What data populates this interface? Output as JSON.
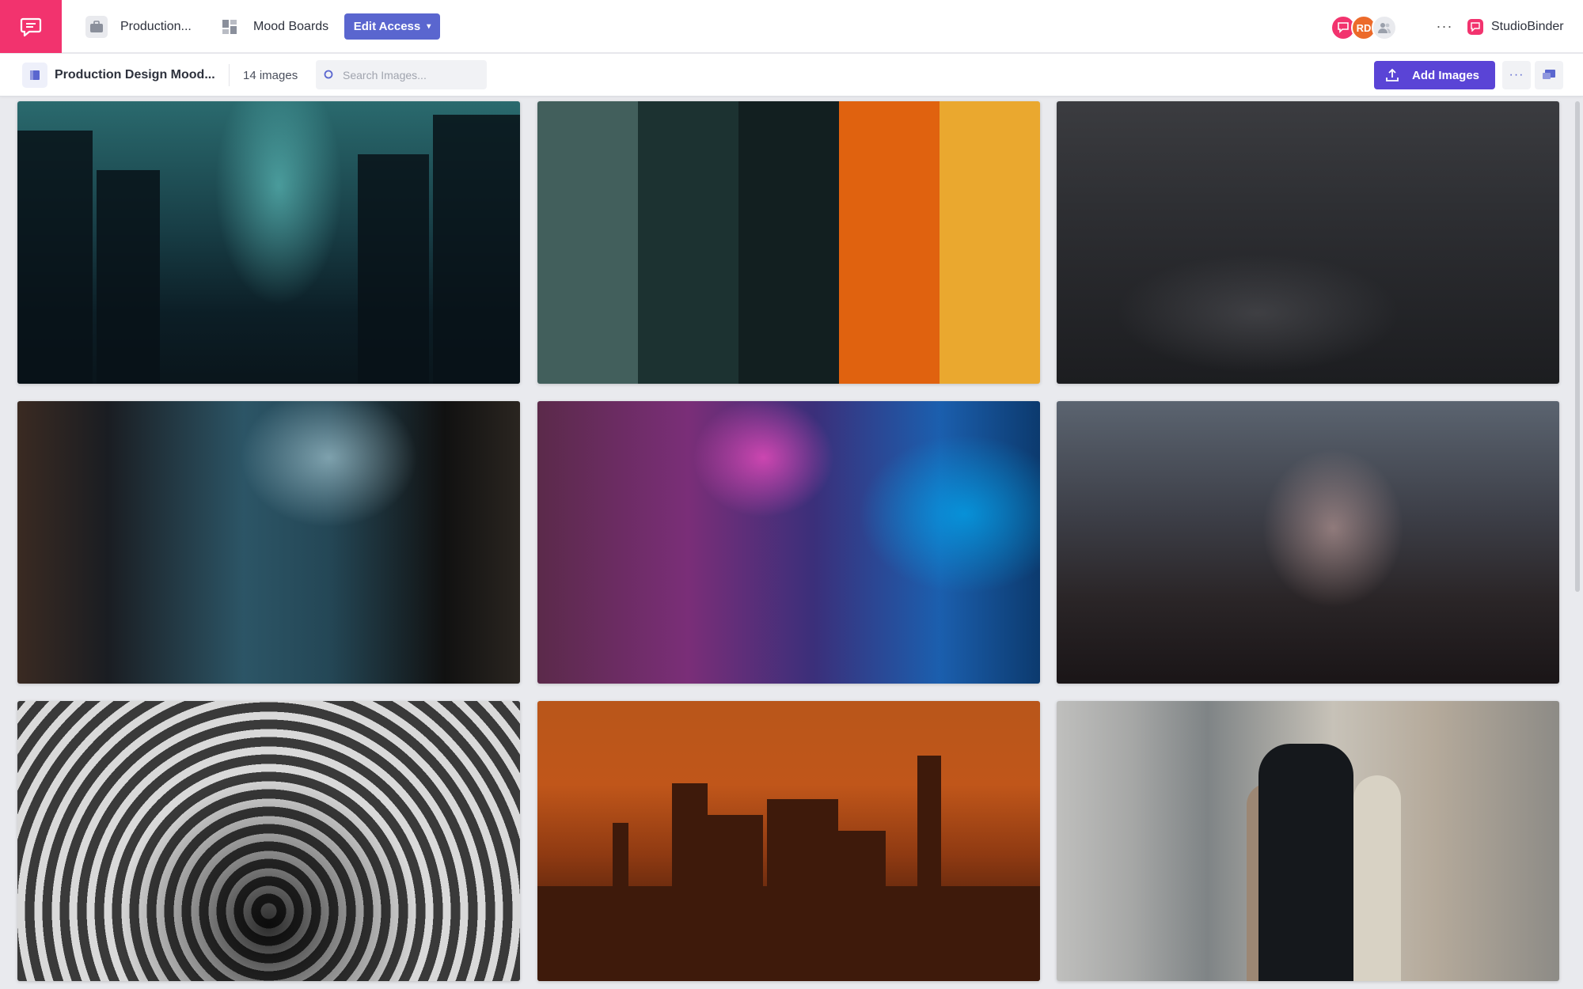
{
  "topbar": {
    "brand_icon": "chat-bubble-icon",
    "breadcrumb_project": "Production...",
    "breadcrumb_section": "Mood Boards",
    "edit_access_label": "Edit Access",
    "avatars": [
      {
        "initials": "",
        "icon": "chat-bubble-icon",
        "color": "#f2336e"
      },
      {
        "initials": "RD",
        "color": "#ec6a2a"
      },
      {
        "initials": "",
        "icon": "people-icon",
        "color": "#e9eaee"
      }
    ],
    "more_label": "···",
    "app_name": "StudioBinder"
  },
  "subbar": {
    "board_title": "Production Design Mood...",
    "image_count": "14 images",
    "search_placeholder": "Search Images...",
    "add_images_label": "Add Images",
    "more_label": "···"
  },
  "colors": {
    "brand_pink": "#f2336e",
    "accent_blue": "#5a66cf",
    "add_button": "#5a44d6"
  },
  "palette_swatches": [
    "#425f5c",
    "#1c3231",
    "#121f20",
    "#e0620f",
    "#eaa82f"
  ]
}
